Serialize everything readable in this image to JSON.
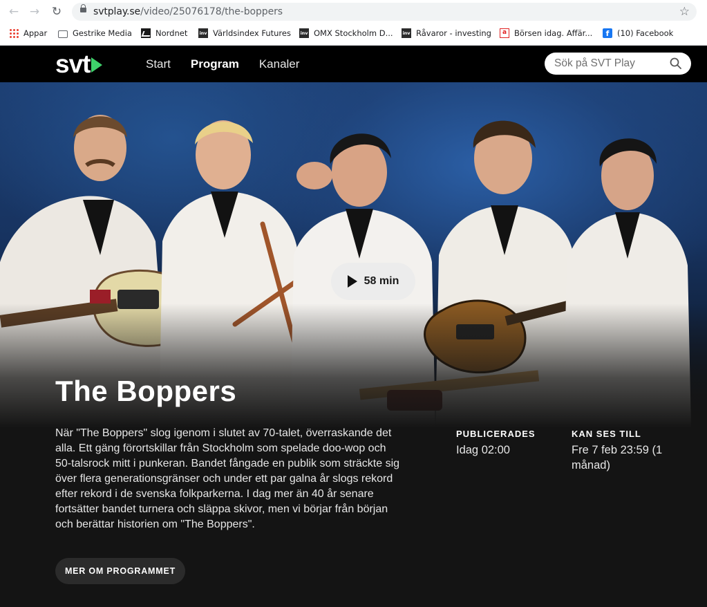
{
  "browser": {
    "url_host": "svtplay.se",
    "url_path": "/video/25076178/the-boppers",
    "bookmarks": [
      {
        "label": "Appar",
        "icon": "apps-grid-icon"
      },
      {
        "label": "Gestrike Media",
        "icon": "folder-icon"
      },
      {
        "label": "Nordnet",
        "icon": "nordnet-icon"
      },
      {
        "label": "Världsindex Futures",
        "icon": "investing-icon"
      },
      {
        "label": "OMX Stockholm D...",
        "icon": "investing-icon"
      },
      {
        "label": "Råvaror - investing",
        "icon": "investing-icon"
      },
      {
        "label": "Börsen idag. Affär...",
        "icon": "borsen-icon"
      },
      {
        "label": "(10) Facebook",
        "icon": "facebook-icon"
      }
    ],
    "icon_badges": {
      "investing": "inv",
      "borsen": "a",
      "facebook": "f"
    }
  },
  "header": {
    "logo": "svt",
    "nav": [
      {
        "label": "Start",
        "active": false
      },
      {
        "label": "Program",
        "active": true
      },
      {
        "label": "Kanaler",
        "active": false
      }
    ],
    "search_placeholder": "Sök på SVT Play"
  },
  "hero": {
    "duration_label": "58 min"
  },
  "program": {
    "title": "The Boppers",
    "description": "När \"The Boppers\" slog igenom i slutet av 70-talet, överraskande det alla. Ett gäng förortskillar från Stockholm som spelade doo-wop och 50-talsrock mitt i punkeran. Bandet fångade en publik som sträckte sig över flera generationsgränser och under ett par galna år slogs rekord efter rekord i de svenska folkparkerna. I dag mer än 40 år senare fortsätter bandet turnera och släppa skivor, men vi börjar från början och berättar historien om \"The Boppers\".",
    "published_label": "PUBLICERADES",
    "published_value": "Idag 02:00",
    "available_label": "KAN SES TILL",
    "available_value": "Fre 7 feb 23:59 (1 månad)",
    "more_button": "MER OM PROGRAMMET"
  },
  "colors": {
    "accent_green": "#3fd16b",
    "page_bg": "#141414",
    "header_bg": "#000000"
  }
}
